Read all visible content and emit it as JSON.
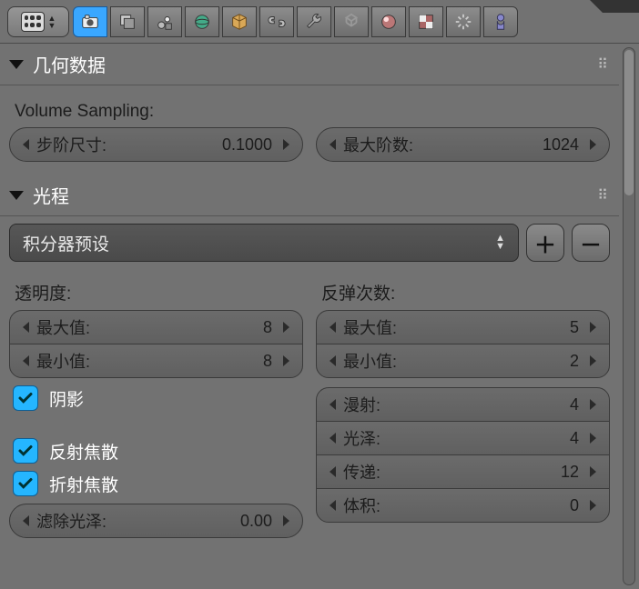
{
  "tabs": {
    "mode_icon": "context-mode"
  },
  "panels": {
    "geometry": {
      "title": "几何数据",
      "volume_sampling_label": "Volume Sampling:",
      "step_size": {
        "label": "步阶尺寸:",
        "value": "0.1000"
      },
      "max_steps": {
        "label": "最大阶数:",
        "value": "1024"
      }
    },
    "light_paths": {
      "title": "光程",
      "preset_label": "积分器预设",
      "transparency": {
        "header": "透明度:",
        "max": {
          "label": "最大值:",
          "value": "8"
        },
        "min": {
          "label": "最小值:",
          "value": "8"
        }
      },
      "bounces": {
        "header": "反弹次数:",
        "max": {
          "label": "最大值:",
          "value": "5"
        },
        "min": {
          "label": "最小值:",
          "value": "2"
        },
        "diffuse": {
          "label": "漫射:",
          "value": "4"
        },
        "glossy": {
          "label": "光泽:",
          "value": "4"
        },
        "transmission": {
          "label": "传递:",
          "value": "12"
        },
        "volume": {
          "label": "体积:",
          "value": "0"
        }
      },
      "shadows_label": "阴影",
      "reflective_caustics_label": "反射焦散",
      "refractive_caustics_label": "折射焦散",
      "filter_glossy": {
        "label": "滤除光泽:",
        "value": "0.00"
      }
    }
  }
}
